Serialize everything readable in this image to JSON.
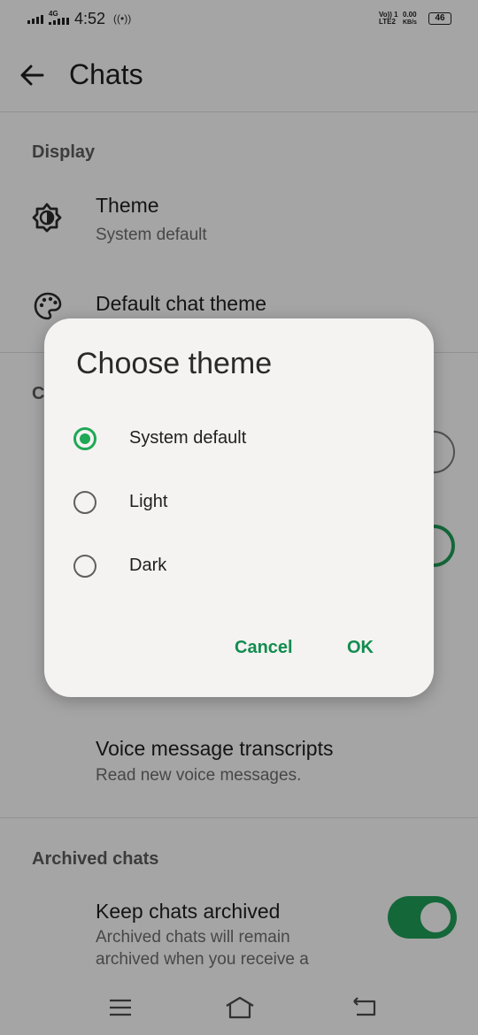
{
  "status_bar": {
    "network": "4G",
    "time": "4:52",
    "volte": "Vo)) 1",
    "lte": "LTE2",
    "speed": "0.00",
    "speed_unit": "KB/s",
    "battery": "46"
  },
  "app_bar": {
    "title": "Chats",
    "back_icon": "arrow-left-icon"
  },
  "display_section": {
    "header": "Display",
    "theme": {
      "title": "Theme",
      "subtitle": "System default",
      "icon": "brightness-icon"
    },
    "default_chat_theme": {
      "title": "Default chat theme",
      "icon": "palette-icon"
    }
  },
  "partial_section_header": "C",
  "voice_transcripts": {
    "title": "Voice message transcripts",
    "subtitle": "Read new voice messages."
  },
  "archived_section": {
    "header": "Archived chats",
    "keep_archived": {
      "title": "Keep chats archived",
      "subtitle_line1": "Archived chats will remain",
      "subtitle_line2": "archived when you receive a",
      "enabled": true
    }
  },
  "dialog": {
    "title": "Choose theme",
    "options": [
      {
        "label": "System default",
        "selected": true
      },
      {
        "label": "Light",
        "selected": false
      },
      {
        "label": "Dark",
        "selected": false
      }
    ],
    "cancel_label": "Cancel",
    "ok_label": "OK"
  },
  "colors": {
    "accent": "#1fa855",
    "button_text": "#128c4f",
    "scrim": "rgba(0,0,0,0.33)"
  },
  "nav_bar": {
    "icons": [
      "menu-icon",
      "home-icon",
      "back-icon"
    ]
  }
}
